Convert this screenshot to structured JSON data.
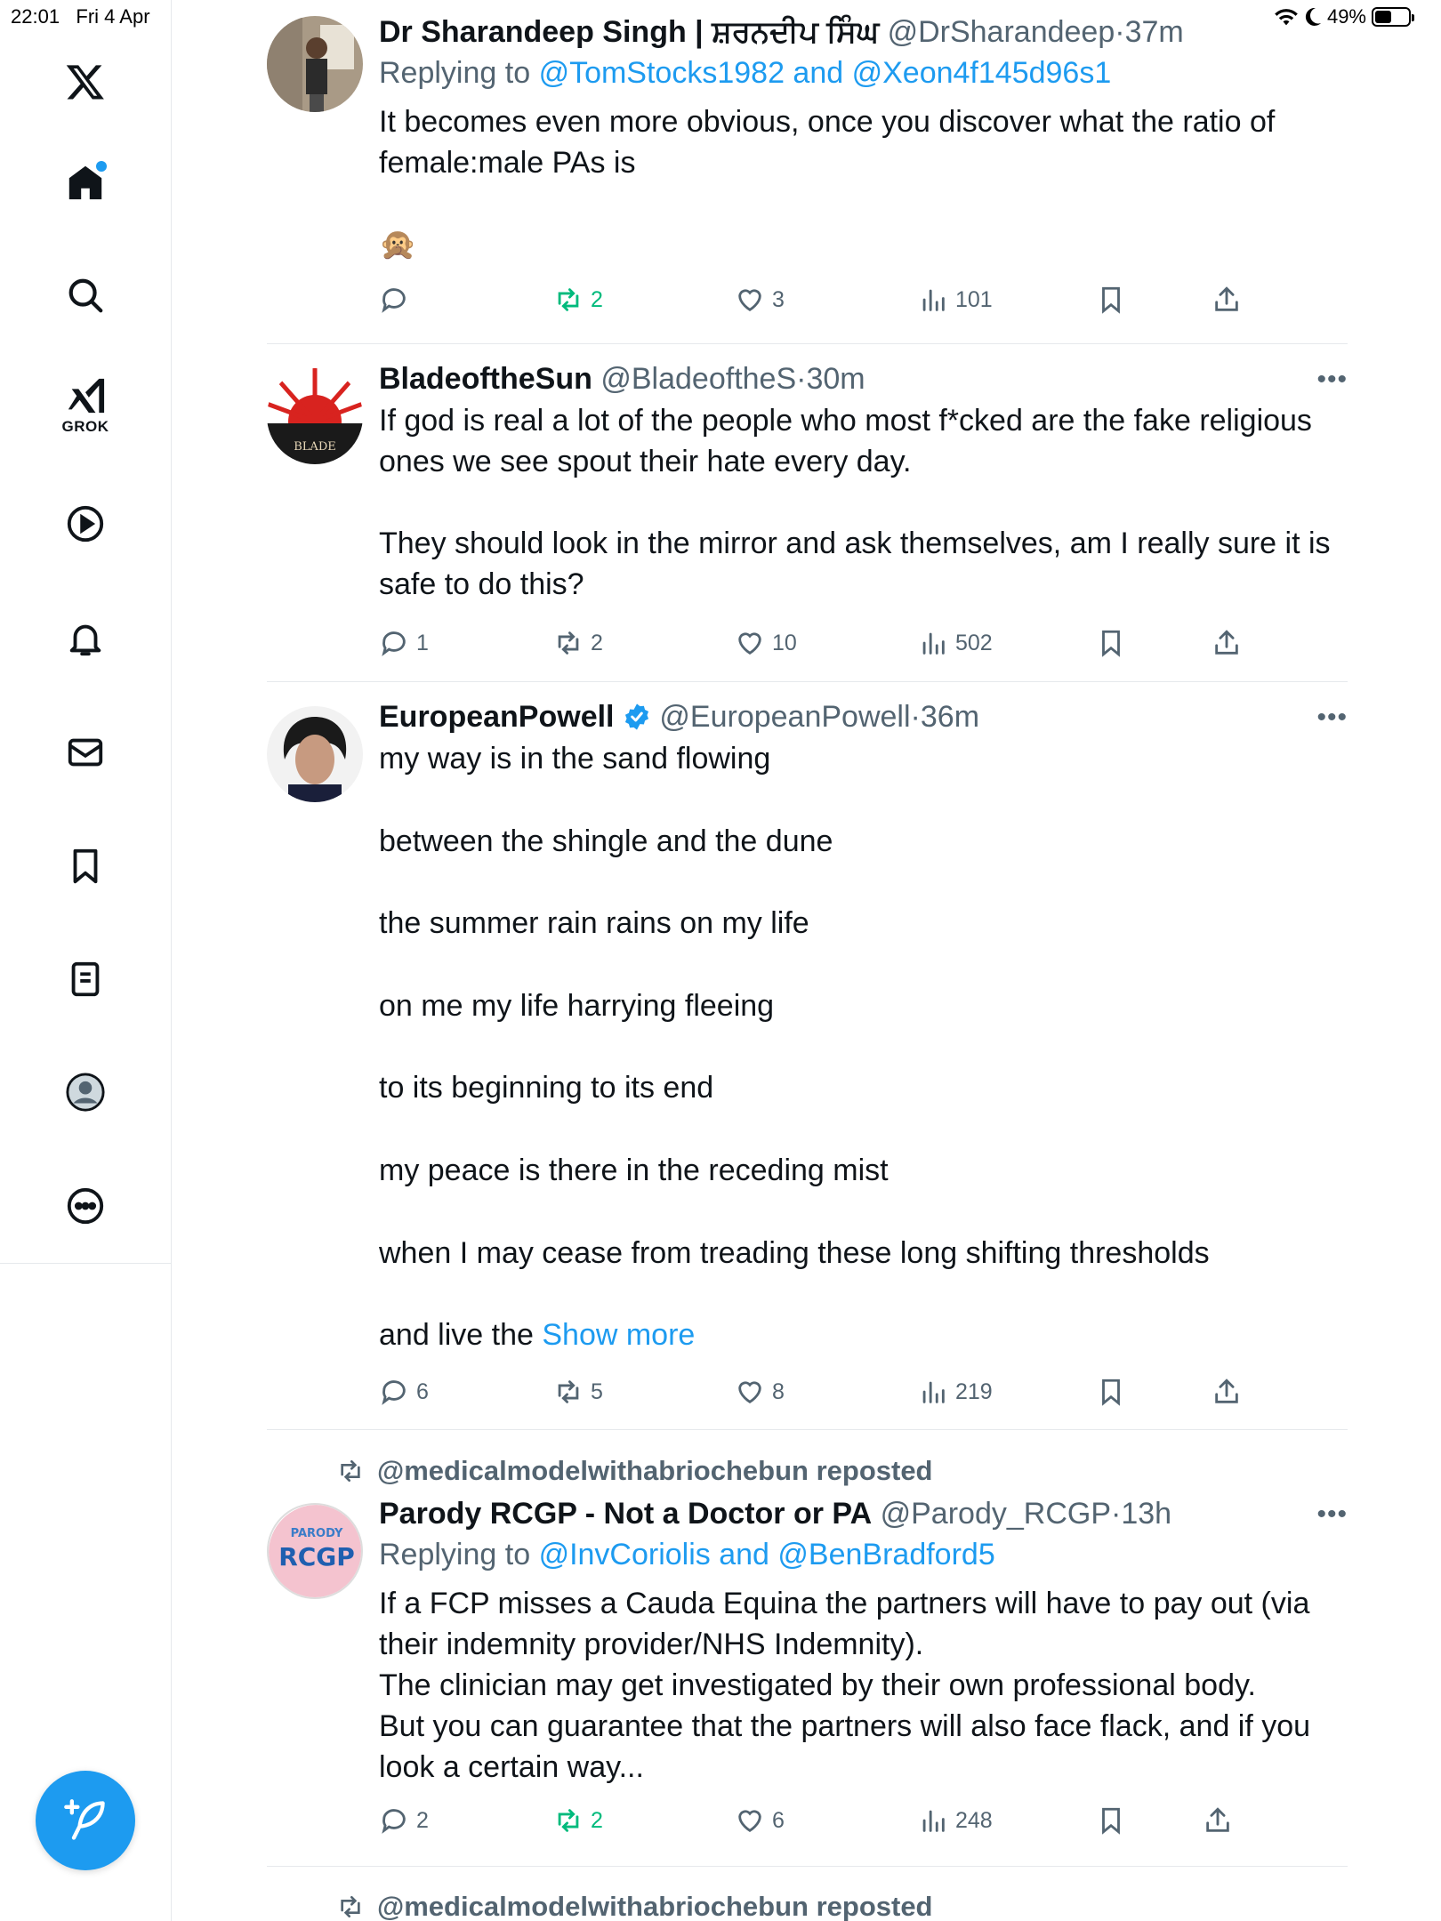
{
  "status": {
    "time": "22:01",
    "date": "Fri 4 Apr",
    "battery": "49%",
    "battery_level": 0.49
  },
  "sidebar": {
    "items": [
      {
        "icon": "x-logo-icon"
      },
      {
        "icon": "home-icon"
      },
      {
        "icon": "search-icon"
      },
      {
        "icon": "grok-icon",
        "label": "GROK"
      },
      {
        "icon": "video-play-icon"
      },
      {
        "icon": "bell-icon"
      },
      {
        "icon": "mail-icon"
      },
      {
        "icon": "bookmark-icon"
      },
      {
        "icon": "lists-icon"
      },
      {
        "icon": "profile-icon"
      },
      {
        "icon": "more-circle-icon"
      }
    ]
  },
  "feed": {
    "tweets": [
      {
        "name": "Dr Sharandeep Singh | ਸ਼ਰਨਦੀਪ ਸਿੰਘ",
        "handle": "@DrSharandeep",
        "time": "37m",
        "replying_prefix": "Replying to",
        "replying_to": "@TomStocks1982 and @Xeon4f145d96s1",
        "text": "It becomes even more obvious, once you discover what the ratio of\nfemale:male PAs is\n\n🙊",
        "replies": "",
        "reposts": "2",
        "likes": "3",
        "views": "101"
      },
      {
        "name": "BladeoftheSun",
        "handle": "@BladeoftheS",
        "time": "30m",
        "text": "If god is real a lot of the people who most f*cked are the fake religious\nones we see spout their hate every day.\n\nThey should look in the mirror and ask themselves, am I really sure it is\nsafe to do this?",
        "replies": "1",
        "reposts": "2",
        "likes": "10",
        "views": "502"
      },
      {
        "name": "EuropeanPowell",
        "handle": "@EuropeanPowell",
        "time": "36m",
        "text": "my way is in the sand flowing\n\nbetween the shingle and the dune\n\nthe summer rain rains on my life\n\non me my life harrying fleeing\n\nto its beginning to its end\n\nmy peace is there in the receding mist\n\nwhen I may cease from treading these long shifting thresholds\n\nand live the ",
        "show_more": "Show more",
        "replies": "6",
        "reposts": "5",
        "likes": "8",
        "views": "219"
      },
      {
        "repost_by": "@medicalmodelwithabriochebun reposted",
        "name": "Parody RCGP - Not a Doctor or PA",
        "handle": "@Parody_RCGP",
        "time": "13h",
        "avatar_text_top": "PARODY",
        "avatar_text": "RCGP",
        "replying_prefix": "Replying to",
        "replying_to": "@InvCoriolis and @BenBradford5",
        "text": "If a FCP misses a Cauda Equina the partners will have to pay out (via\ntheir indemnity provider/NHS Indemnity).\nThe clinician may get investigated by their own professional body.\nBut you can guarantee that the partners will also face flack, and if you\nlook a certain way...",
        "replies": "2",
        "reposts": "2",
        "likes": "6",
        "views": "248"
      }
    ],
    "next_repost_by": "@medicalmodelwithabriochebun reposted"
  }
}
